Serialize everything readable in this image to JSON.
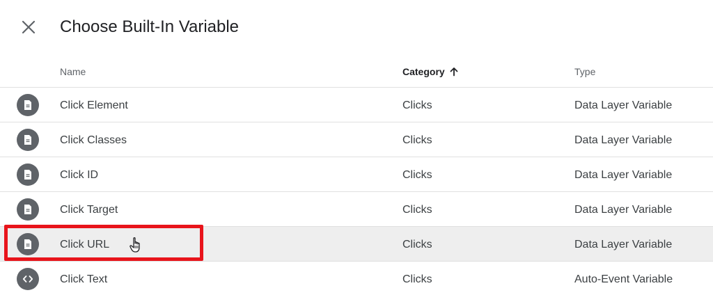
{
  "dialog": {
    "title": "Choose Built-In Variable",
    "close_icon": "close-icon"
  },
  "table": {
    "columns": {
      "name": "Name",
      "category": "Category",
      "type": "Type",
      "sort_icon": "arrow-up-icon"
    },
    "rows": [
      {
        "name": "Click Element",
        "category": "Clicks",
        "type": "Data Layer Variable",
        "icon": "document-icon"
      },
      {
        "name": "Click Classes",
        "category": "Clicks",
        "type": "Data Layer Variable",
        "icon": "document-icon"
      },
      {
        "name": "Click ID",
        "category": "Clicks",
        "type": "Data Layer Variable",
        "icon": "document-icon"
      },
      {
        "name": "Click Target",
        "category": "Clicks",
        "type": "Data Layer Variable",
        "icon": "document-icon"
      },
      {
        "name": "Click URL",
        "category": "Clicks",
        "type": "Data Layer Variable",
        "icon": "document-icon"
      },
      {
        "name": "Click Text",
        "category": "Clicks",
        "type": "Auto-Event Variable",
        "icon": "code-icon"
      }
    ]
  },
  "colors": {
    "highlight": "#e8141b",
    "icon_bg": "#5f6368",
    "hover_row": "#eeeeee"
  }
}
